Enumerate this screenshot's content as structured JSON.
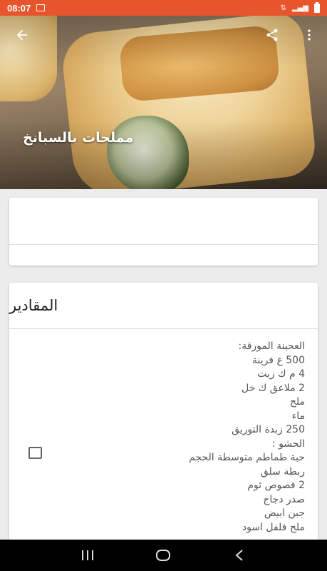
{
  "status_bar": {
    "time": "08:07",
    "icons": [
      "gallery-icon",
      "data-arrows-icon",
      "signal-icon",
      "battery-icon"
    ]
  },
  "hero": {
    "title": "مملحات بالسبانخ",
    "back_icon": "arrow-left-icon",
    "share_icon": "share-icon",
    "more_icon": "more-vert-icon"
  },
  "ingredients": {
    "heading": "المقادير",
    "items": [
      "العجينة المورقة:",
      "500 غ فرينة",
      "4 م ك زيت",
      "2 ملاعق ك خل",
      "ملح",
      "ماء",
      "250 زبدة التوريق",
      "الحشو :",
      "حبة طماطم متوسطة الحجم",
      "ربطة سلق",
      "2 فصوص ثوم",
      "صدر دجاج",
      "جبن ابيض",
      "ملح فلفل اسود"
    ]
  },
  "nav_bar": {
    "icons": [
      "recent-apps-icon",
      "home-icon",
      "back-icon"
    ]
  }
}
